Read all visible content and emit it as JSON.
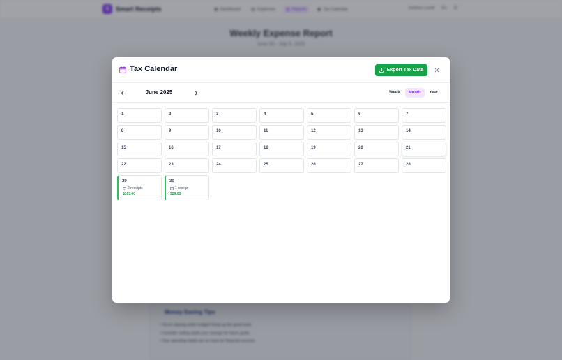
{
  "app": {
    "brand_initial": "S",
    "name": "Smart Receipts",
    "nav": [
      {
        "label": "Dashboard",
        "icon": "dashboard-icon"
      },
      {
        "label": "Expenses",
        "icon": "receipt-icon"
      },
      {
        "label": "Reports",
        "icon": "chart-icon"
      },
      {
        "label": "Tax Calendar",
        "icon": "calendar-icon"
      }
    ],
    "user_label": "Andrew Lovell",
    "lang_label": "En"
  },
  "report": {
    "title": "Weekly Expense Report",
    "date_range": "June 30 - July 5, 2025"
  },
  "tips": {
    "title": "Money-Saving Tips",
    "items": [
      "You're staying under budget! Keep up the good work.",
      "Consider setting aside your savings for future goals.",
      "Your spending habits are on track for financial success."
    ]
  },
  "modal": {
    "title": "Tax Calendar",
    "export_label": "Export Tax Data",
    "month_label": "June 2025",
    "view_tabs": [
      "Week",
      "Month",
      "Year"
    ],
    "active_view": "Month",
    "days": [
      {
        "d": "1"
      },
      {
        "d": "2"
      },
      {
        "d": "3"
      },
      {
        "d": "4"
      },
      {
        "d": "5"
      },
      {
        "d": "6"
      },
      {
        "d": "7"
      },
      {
        "d": "8"
      },
      {
        "d": "9"
      },
      {
        "d": "10"
      },
      {
        "d": "11"
      },
      {
        "d": "12"
      },
      {
        "d": "13"
      },
      {
        "d": "14"
      },
      {
        "d": "15"
      },
      {
        "d": "16"
      },
      {
        "d": "17"
      },
      {
        "d": "18"
      },
      {
        "d": "19"
      },
      {
        "d": "20"
      },
      {
        "d": "21",
        "hover": true
      },
      {
        "d": "22"
      },
      {
        "d": "23"
      },
      {
        "d": "24"
      },
      {
        "d": "25"
      },
      {
        "d": "26"
      },
      {
        "d": "27"
      },
      {
        "d": "28"
      },
      {
        "d": "29",
        "receipts": "2 receipts",
        "amount": "$163.00"
      },
      {
        "d": "30",
        "receipts": "1 receipt",
        "amount": "$29.00"
      }
    ]
  },
  "colors": {
    "accent": "#7c3aed",
    "export_green": "#16a34a",
    "active_tab_bg": "#f2e6ff",
    "active_tab_text": "#9333ea",
    "receipt_border": "#22c55e"
  }
}
